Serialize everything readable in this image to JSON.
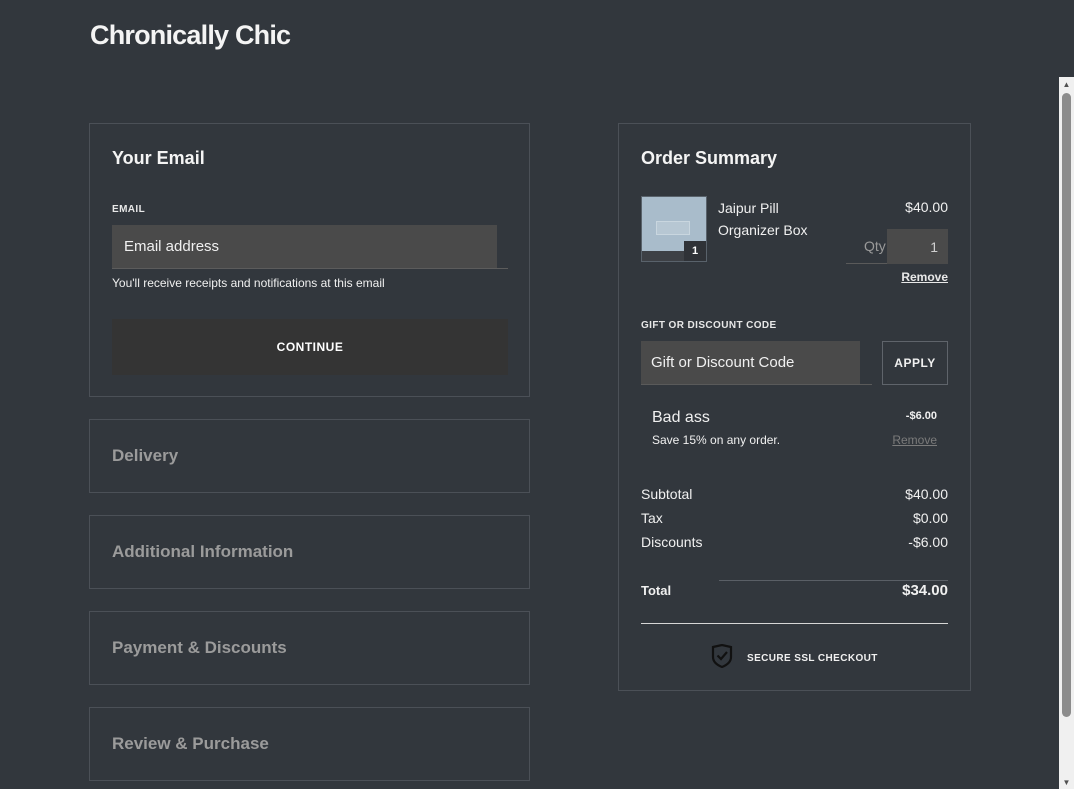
{
  "brand": "Chronically Chic",
  "email_section": {
    "title": "Your Email",
    "field_label": "EMAIL",
    "placeholder": "Email address",
    "help_text": "You'll receive receipts and notifications at this email",
    "continue_label": "CONTINUE"
  },
  "steps": [
    {
      "label": "Delivery"
    },
    {
      "label": "Additional Information"
    },
    {
      "label": "Payment & Discounts"
    },
    {
      "label": "Review & Purchase"
    }
  ],
  "summary": {
    "title": "Order Summary",
    "item": {
      "name": "Jaipur Pill Organizer Box",
      "price": "$40.00",
      "qty_label": "Qty",
      "qty": "1",
      "badge_qty": "1",
      "remove_label": "Remove"
    },
    "gift_label": "GIFT OR DISCOUNT CODE",
    "gift_placeholder": "Gift or Discount Code",
    "apply_label": "APPLY",
    "promo": {
      "name": "Bad ass",
      "description": "Save 15% on any order.",
      "amount": "-$6.00",
      "remove_label": "Remove"
    },
    "subtotal_label": "Subtotal",
    "subtotal": "$40.00",
    "tax_label": "Tax",
    "tax": "$0.00",
    "discounts_label": "Discounts",
    "discounts": "-$6.00",
    "total_label": "Total",
    "total": "$34.00",
    "ssl_label": "SECURE SSL CHECKOUT"
  },
  "colors": {
    "background": "#32373d",
    "input_bg": "#4a4a4a",
    "button_dark": "#343434",
    "muted_text": "#9b9b9b"
  }
}
